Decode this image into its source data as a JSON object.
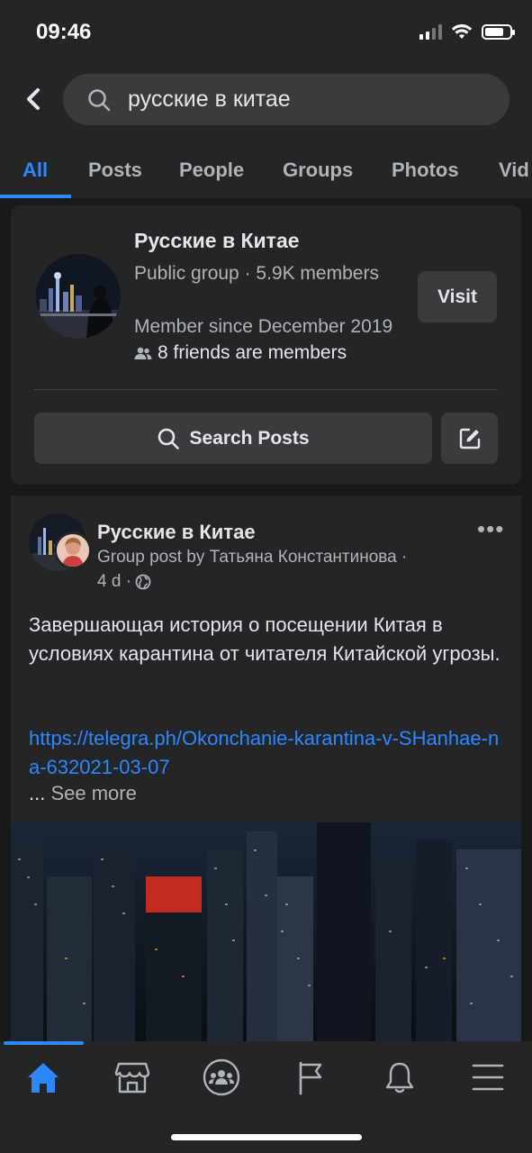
{
  "status_bar": {
    "time": "09:46"
  },
  "search": {
    "query": "русские в китае"
  },
  "tabs": [
    {
      "label": "All",
      "active": true
    },
    {
      "label": "Posts"
    },
    {
      "label": "People"
    },
    {
      "label": "Groups"
    },
    {
      "label": "Photos"
    },
    {
      "label": "Vid"
    }
  ],
  "group_result": {
    "name": "Русские в Китае",
    "meta": "Public group · 5.9K members",
    "member_since": "Member since December 2019",
    "friends": "8 friends are members",
    "visit_label": "Visit",
    "search_posts_label": "Search Posts"
  },
  "post": {
    "group_name": "Русские в Китае",
    "byline": "Group post by Татьяна Константинова ·",
    "time": "4 d ·",
    "text": "Завершающая история о посещении Китая в условиях карантина от читателя Китайской угрозы.",
    "link": "https://telegra.ph/Okonchanie-karantina-v-SHanhae-na-632021-03-07",
    "ellipsis": "...",
    "see_more": "See more"
  },
  "bottom_nav": [
    "home-icon",
    "marketplace-icon",
    "groups-icon",
    "pages-flag-icon",
    "notifications-icon",
    "menu-icon"
  ],
  "colors": {
    "accent": "#2d88ff",
    "background": "#18191a",
    "surface": "#242526",
    "button": "#3a3b3c"
  }
}
